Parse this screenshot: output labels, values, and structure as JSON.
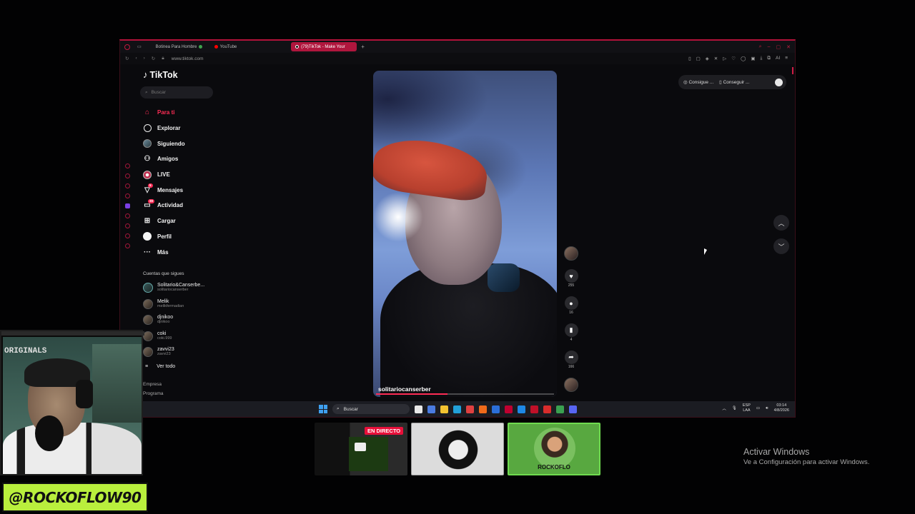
{
  "browser": {
    "tabs": [
      {
        "label": "Botinea Para Hombre",
        "icon": "shoe-icon",
        "color": "#3fa34d"
      },
      {
        "label": "YouTube",
        "icon": "youtube-icon",
        "color": "#ff0000"
      },
      {
        "label": "(79)TikTok - Make Your",
        "icon": "tiktok-icon",
        "color": "#ffffff",
        "active": true
      }
    ],
    "new_tab": "+",
    "url": "www.tiktok.com",
    "ai_label": "AI"
  },
  "tiktok": {
    "logo_text": "TikTok",
    "search_placeholder": "Buscar",
    "nav": [
      {
        "label": "Para ti",
        "icon": "home-icon",
        "active": true
      },
      {
        "label": "Explorar",
        "icon": "compass-icon"
      },
      {
        "label": "Siguiendo",
        "icon": "following-avatar-icon"
      },
      {
        "label": "Amigos",
        "icon": "friends-icon"
      },
      {
        "label": "LIVE",
        "icon": "live-icon"
      },
      {
        "label": "Mensajes",
        "icon": "messages-icon",
        "badge": "5"
      },
      {
        "label": "Actividad",
        "icon": "activity-icon",
        "badge": "39"
      },
      {
        "label": "Cargar",
        "icon": "upload-icon"
      },
      {
        "label": "Perfil",
        "icon": "profile-icon"
      },
      {
        "label": "Más",
        "icon": "more-icon"
      }
    ],
    "following_title": "Cuentas que sigues",
    "following": [
      {
        "name": "Solitario&Canserbe...",
        "handle": "solitariocanserber"
      },
      {
        "name": "Melik",
        "handle": "melikfermadian"
      },
      {
        "name": "djnikoo",
        "handle": "djnikoo"
      },
      {
        "name": "coki",
        "handle": "coki.999"
      },
      {
        "name": "zavvi23",
        "handle": "zavvi23"
      }
    ],
    "see_all": "Ver todo",
    "footer": [
      "Empresa",
      "Programa"
    ],
    "promo": {
      "item1": "Consigue ...",
      "item2": "Conseguir ..."
    },
    "video": {
      "username": "solitariocanserber",
      "progress": 0.4
    },
    "actions": {
      "likes": "255",
      "comments": "16",
      "saves": "4",
      "shares": "166"
    }
  },
  "taskbar": {
    "search": "Buscar",
    "lang1": "ESP",
    "lang2": "LAA",
    "time": "03:14",
    "date": "4/8/2026",
    "app_colors": [
      "#e8e8e8",
      "#4a7be0",
      "#f2c230",
      "#22a0d8",
      "#e04040",
      "#f06a1a",
      "#2b6ed8",
      "#c00030",
      "#1e88e5",
      "#c01028",
      "#d82c2c",
      "#3aa050",
      "#5865f2"
    ]
  },
  "overlay": {
    "cam_title": "ORIGINALS",
    "handle": "@ROCKOFLOW90",
    "live_badge": "EN DIRECTO",
    "thumb3_text": "ROCKOFLO",
    "activate_title": "Activar Windows",
    "activate_sub": "Ve a Configuración para activar Windows."
  }
}
